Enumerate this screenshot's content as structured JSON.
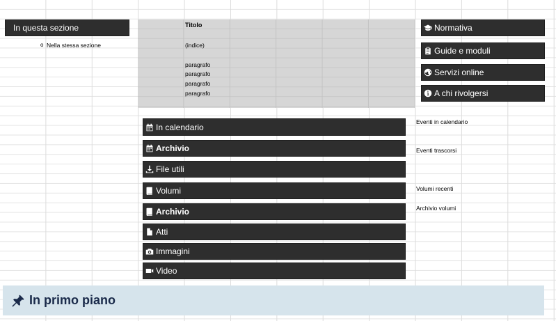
{
  "left_nav": {
    "section_title": "In questa sezione",
    "bullet": "o",
    "item": "Nella stessa sezione"
  },
  "content_block": {
    "title": "Titolo",
    "index": "(indice)",
    "paragraphs": [
      "paragrafo",
      "paragrafo",
      "paragrafo",
      "paragrafo"
    ]
  },
  "right_menu": [
    {
      "label": "Normativa",
      "icon": "graduation-cap-icon"
    },
    {
      "label": "Guide e moduli",
      "icon": "clipboard-icon"
    },
    {
      "label": "Servizi online",
      "icon": "globe-icon"
    },
    {
      "label": "A chi rivolgersi",
      "icon": "info-circle-icon"
    }
  ],
  "center_menu": [
    {
      "label": "In calendario",
      "icon": "calendar-icon",
      "bold": false
    },
    {
      "label": "Archivio",
      "icon": "calendar-icon",
      "bold": true
    },
    {
      "label": "File utili",
      "icon": "download-icon",
      "bold": false
    },
    {
      "label": "Volumi",
      "icon": "book-icon",
      "bold": false
    },
    {
      "label": "Archivio",
      "icon": "book-icon",
      "bold": true
    },
    {
      "label": "Atti",
      "icon": "file-icon",
      "bold": false
    },
    {
      "label": "Immagini",
      "icon": "camera-icon",
      "bold": false
    },
    {
      "label": "Video",
      "icon": "video-camera-icon",
      "bold": false
    }
  ],
  "side_notes": {
    "events_calendar": "Eventi in calendario",
    "events_past": "Eventi trascorsi",
    "volumes_recent": "Volumi recenti",
    "volumes_archive": "Archivio volumi"
  },
  "highlight": {
    "title": "In primo piano",
    "icon": "pushpin-icon"
  },
  "colors": {
    "dark_bar": "#2e2e2e",
    "grey_block": "#d6d6d6",
    "highlight_bg": "#d6e4ec",
    "highlight_text": "#1a2a4a"
  }
}
